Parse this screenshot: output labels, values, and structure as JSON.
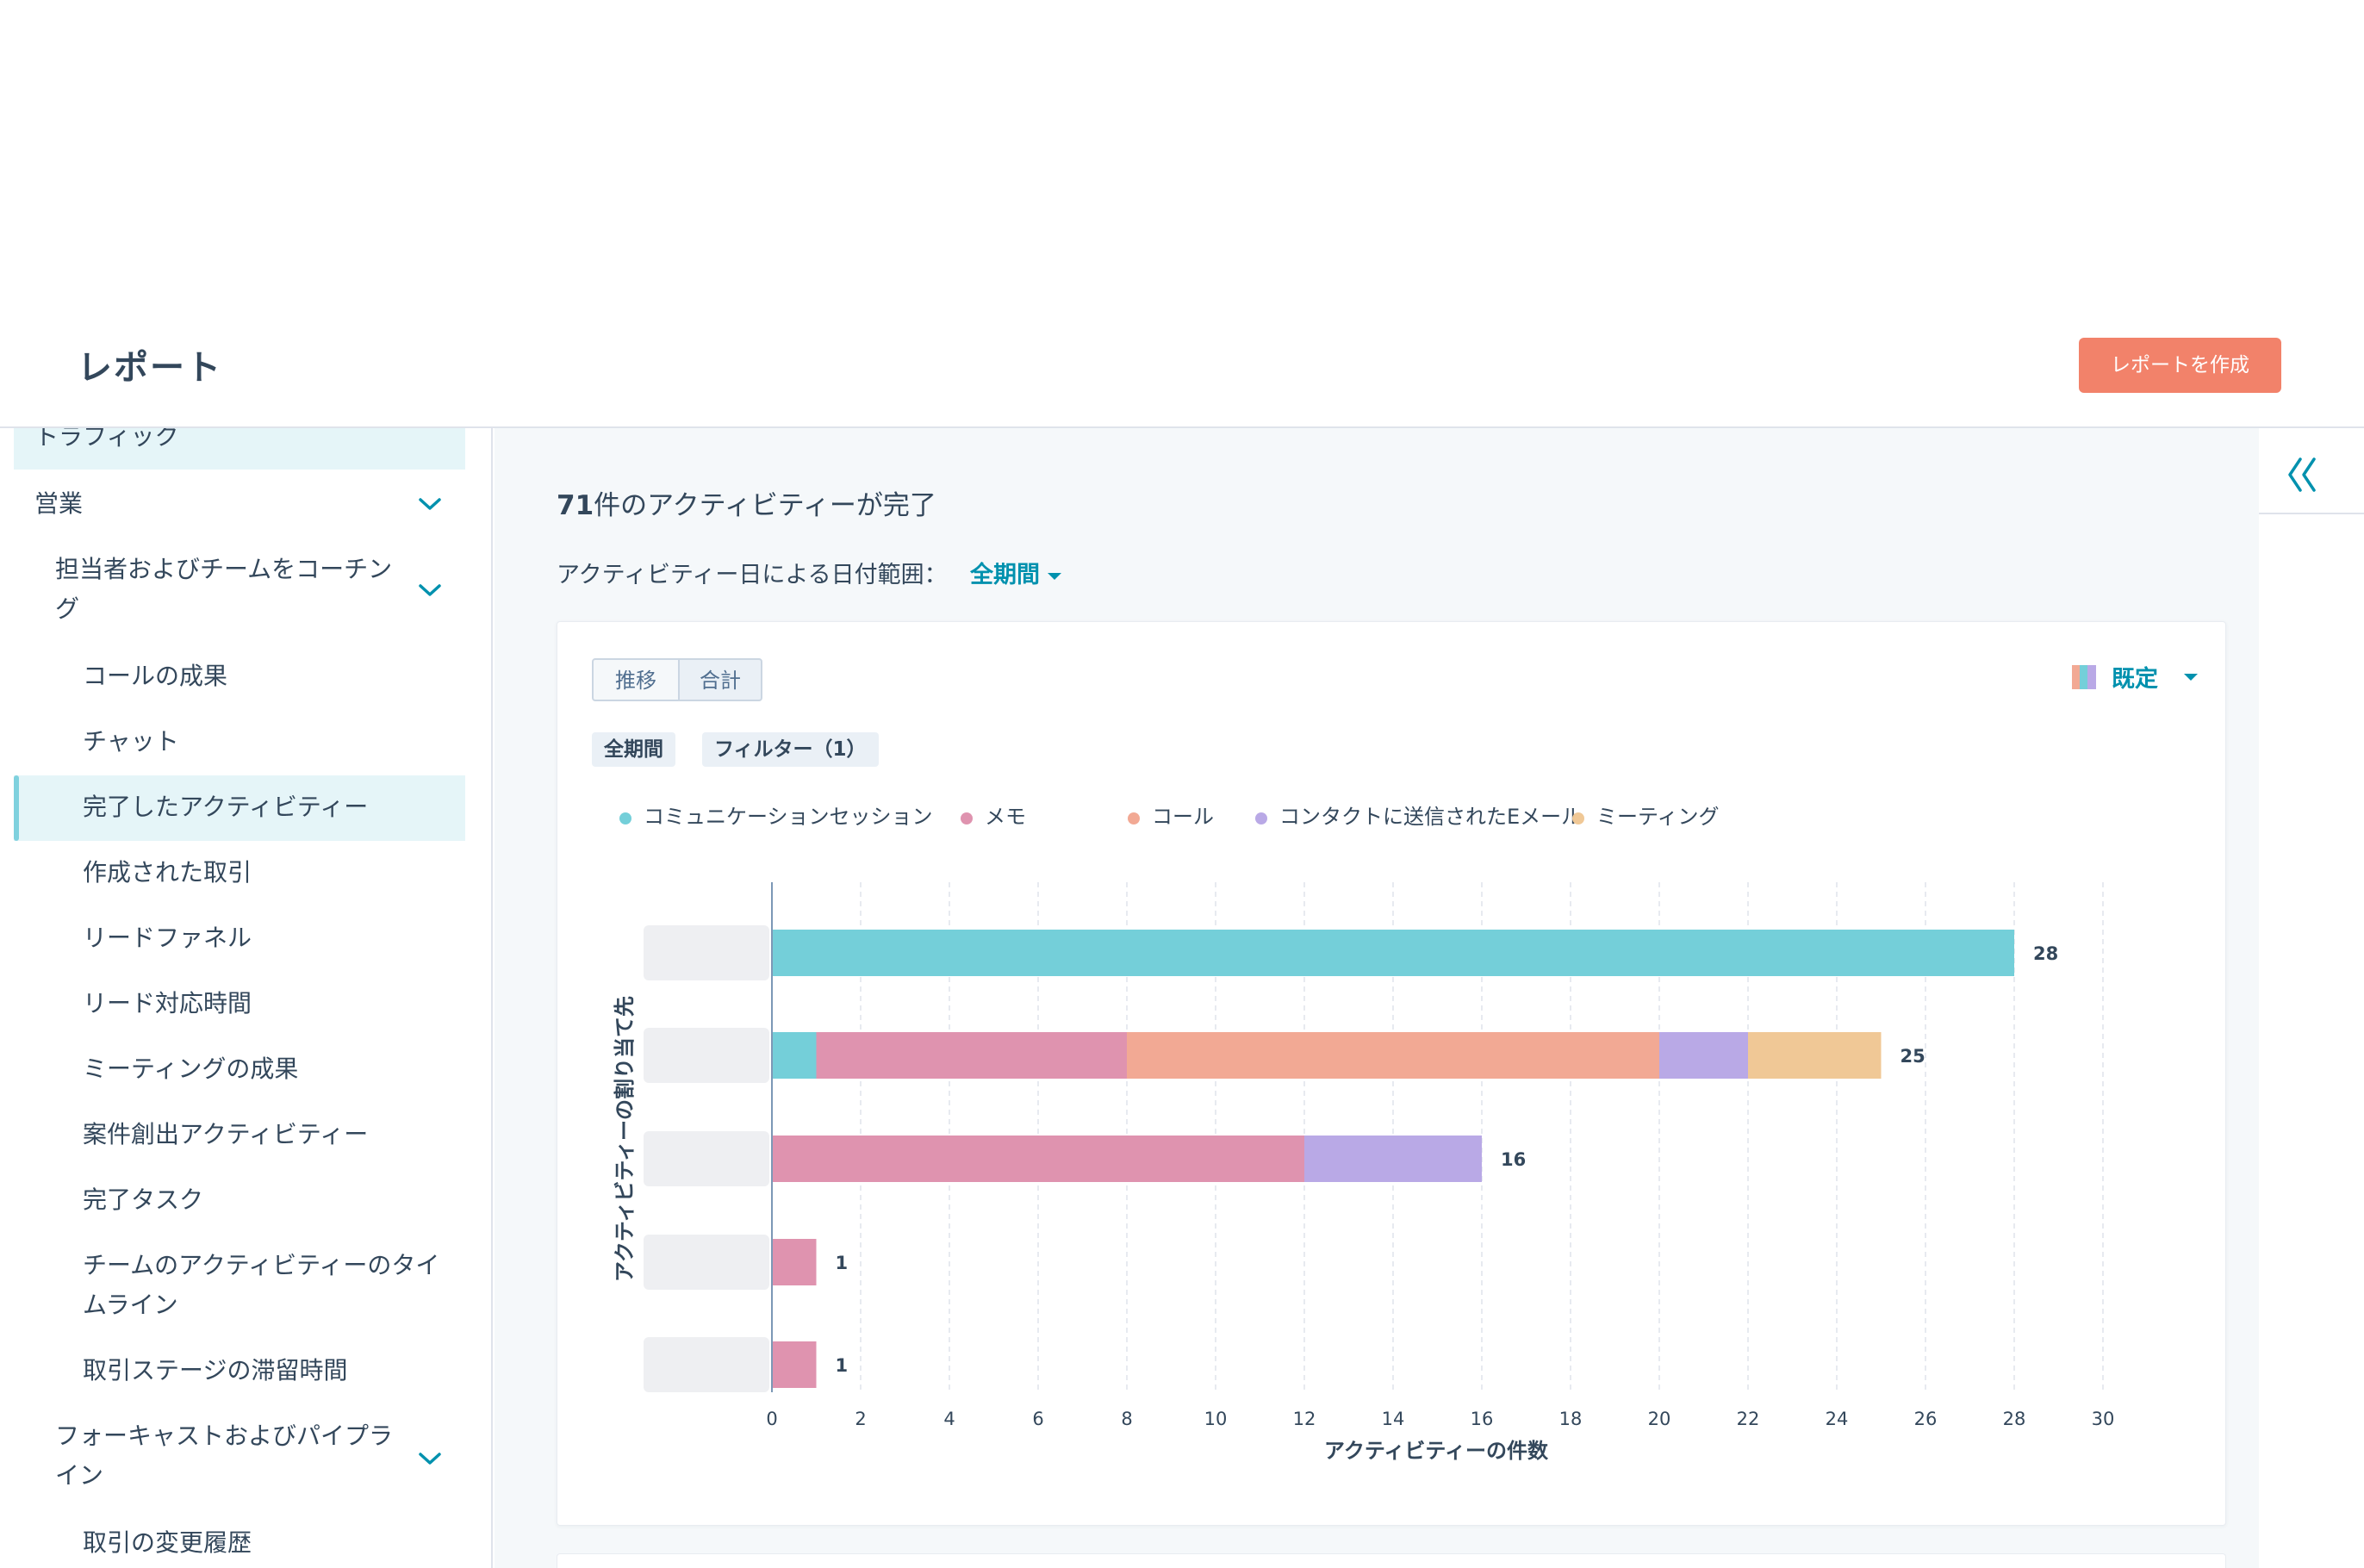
{
  "header": {
    "title": "レポート",
    "create_button": "レポートを作成"
  },
  "sidebar": {
    "items": [
      {
        "label": "トラフィック",
        "level": 0,
        "selected": true
      },
      {
        "label": "営業",
        "level": 0,
        "expandable": true
      },
      {
        "label": "担当者およびチームをコーチン",
        "label_line2": "グ",
        "level": 1,
        "expandable": true
      },
      {
        "label": "コールの成果",
        "level": 2
      },
      {
        "label": "チャット",
        "level": 2
      },
      {
        "label": "完了したアクティビティー",
        "level": 2,
        "active": true
      },
      {
        "label": "作成された取引",
        "level": 2
      },
      {
        "label": "リードファネル",
        "level": 2
      },
      {
        "label": "リード対応時間",
        "level": 2
      },
      {
        "label": "ミーティングの成果",
        "level": 2
      },
      {
        "label": "案件創出アクティビティー",
        "level": 2
      },
      {
        "label": "完了タスク",
        "level": 2
      },
      {
        "label": "チームのアクティビティーのタイ",
        "label_line2": "ムライン",
        "level": 2
      },
      {
        "label": "取引ステージの滞留時間",
        "level": 2
      },
      {
        "label": "フォーキャストおよびパイプラ",
        "label_line2": "イン",
        "level": 1,
        "expandable": true
      },
      {
        "label": "取引の変更履歴",
        "level": 2
      }
    ]
  },
  "main": {
    "summary_count": "71",
    "summary_text": "件のアクティビティーが完了",
    "date_range_label": "アクティビティー日による日付範囲：",
    "date_range_value": "全期間",
    "view_toggle": {
      "trend": "推移",
      "total": "合計",
      "selected": "total"
    },
    "chips": {
      "period": "全期間",
      "filter": "フィルター（1）"
    },
    "chart_style": "既定"
  },
  "colors": {
    "primary": "#0091ae",
    "accent": "#f2826a",
    "text": "#33475b"
  },
  "chart_data": {
    "type": "bar",
    "orientation": "horizontal",
    "stacked": true,
    "categories": [
      "",
      "",
      "",
      "",
      ""
    ],
    "series": [
      {
        "name": "コミュニケーションセッション",
        "color": "#74cfd9",
        "values": [
          28,
          1,
          0,
          0,
          0
        ]
      },
      {
        "name": "メモ",
        "color": "#df93af",
        "values": [
          0,
          7,
          12,
          1,
          1
        ]
      },
      {
        "name": "コール",
        "color": "#f2a994",
        "values": [
          0,
          12,
          0,
          0,
          0
        ]
      },
      {
        "name": "コンタクトに送信されたEメール",
        "color": "#b9a9e6",
        "values": [
          0,
          2,
          4,
          0,
          0
        ]
      },
      {
        "name": "ミーティング",
        "color": "#f0c896",
        "values": [
          0,
          3,
          0,
          0,
          0
        ]
      }
    ],
    "totals": [
      28,
      25,
      16,
      1,
      1
    ],
    "xlabel": "アクティビティーの件数",
    "ylabel": "アクティビティーの割り当て先",
    "xlim": [
      0,
      30
    ],
    "xticks": [
      0,
      2,
      4,
      6,
      8,
      10,
      12,
      14,
      16,
      18,
      20,
      22,
      24,
      26,
      28,
      30
    ],
    "grid": true,
    "legend_position": "top-left"
  }
}
